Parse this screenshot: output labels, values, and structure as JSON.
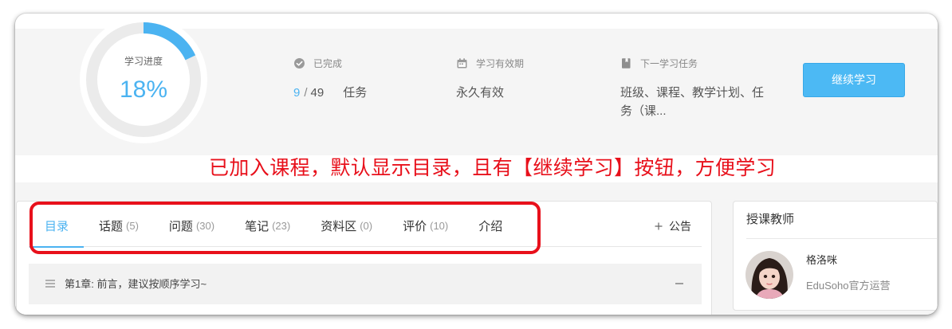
{
  "colors": {
    "accent": "#4bb3f1",
    "button": "#4cb9f4",
    "button_border": "#38a8e8",
    "annotation": "#e8101b",
    "band": "#f5f5f5"
  },
  "progress": {
    "label": "学习进度",
    "percent_text": "18%",
    "percent": 18
  },
  "stats": {
    "completed": {
      "icon": "check-circle-icon",
      "label": "已完成",
      "done": "9",
      "separator": "/",
      "total": "49",
      "unit": "任务"
    },
    "validity": {
      "icon": "calendar-icon",
      "label": "学习有效期",
      "value": "永久有效"
    },
    "next_task": {
      "icon": "book-icon",
      "label": "下一学习任务",
      "value": "班级、课程、教学计划、任务（课..."
    }
  },
  "continue_button": {
    "label": "继续学习"
  },
  "annotation": {
    "note": "已加入课程，默认显示目录，且有【继续学习】按钮，方便学习"
  },
  "tabs": [
    {
      "label": "目录",
      "active": true
    },
    {
      "label": "话题",
      "count": "(5)"
    },
    {
      "label": "问题",
      "count": "(30)"
    },
    {
      "label": "笔记",
      "count": "(23)"
    },
    {
      "label": "资料区",
      "count": "(0)"
    },
    {
      "label": "评价",
      "count": "(10)"
    },
    {
      "label": "介绍"
    }
  ],
  "announcement": {
    "icon": "plus-icon",
    "label": "公告"
  },
  "chapters": [
    {
      "icon": "list-icon",
      "title": "第1章: 前言，建议按顺序学习~",
      "toggle_icon": "minus-icon"
    }
  ],
  "teacher_panel": {
    "title": "授课教师",
    "teachers": [
      {
        "name": "格洛咪",
        "role": "EduSoho官方运营",
        "avatar_icon": "teacher-avatar"
      }
    ]
  }
}
